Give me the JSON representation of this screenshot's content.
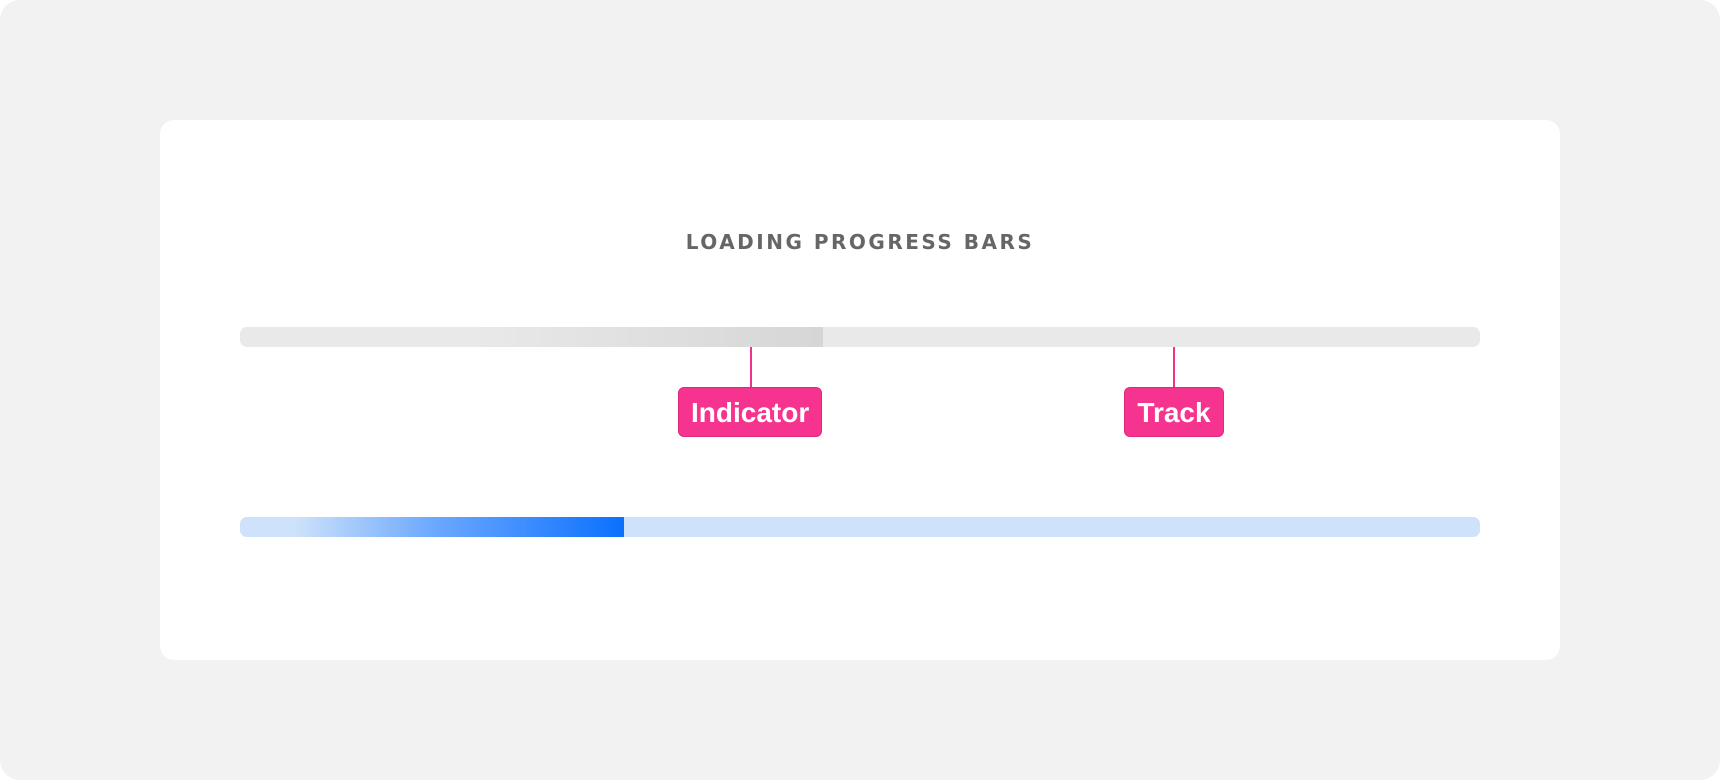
{
  "title": "LOADING PROGRESS BARS",
  "bars": {
    "gray": {
      "progress": 0.47,
      "track_color": "#e9e9e9",
      "indicator_color": "#d6d6d6"
    },
    "blue": {
      "progress": 0.31,
      "track_color": "#cfe2fb",
      "indicator_color": "#0b70ff"
    }
  },
  "labels": {
    "indicator": "Indicator",
    "track": "Track"
  },
  "colors": {
    "background": "#f2f2f2",
    "card": "#ffffff",
    "callout": "#f6338f",
    "title": "#666666"
  }
}
